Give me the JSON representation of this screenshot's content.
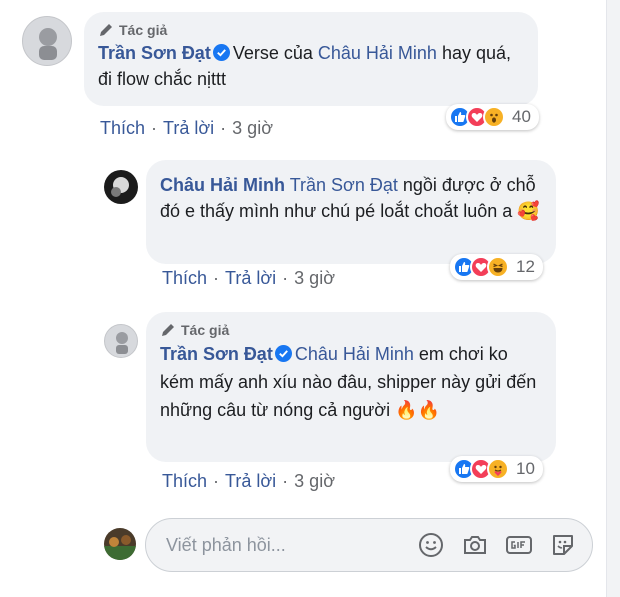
{
  "comments": [
    {
      "author_badge": "Tác giả",
      "author": "Trần Sơn Đạt",
      "mention": "",
      "text_before_mention": "Verse của ",
      "inline_mention": "Châu Hải Minh",
      "text": " hay quá, đi flow chắc nịttt",
      "actions": {
        "like": "Thích",
        "reply": "Trả lời",
        "time": "3 giờ"
      },
      "reactions": {
        "icons": [
          "like-icon",
          "love-icon",
          "wow-icon"
        ],
        "count": "40"
      }
    },
    {
      "author": "Châu Hải Minh",
      "mention": "Trần Sơn Đạt",
      "text": " ngồi được ở chỗ đó e thấy mình như chú pé loắt choắt luôn a 🥰",
      "actions": {
        "like": "Thích",
        "reply": "Trả lời",
        "time": "3 giờ"
      },
      "reactions": {
        "icons": [
          "like-icon",
          "love-icon",
          "haha-icon"
        ],
        "count": "12"
      }
    },
    {
      "author_badge": "Tác giả",
      "author": "Trần Sơn Đạt",
      "mention": "Châu Hải Minh",
      "text": " em chơi ko kém mấy anh xíu nào đâu, shipper này gửi đến những câu từ nóng cả người 🔥🔥",
      "actions": {
        "like": "Thích",
        "reply": "Trả lời",
        "time": "3 giờ"
      },
      "reactions": {
        "icons": [
          "like-icon",
          "love-icon",
          "care-icon"
        ],
        "count": "10"
      }
    }
  ],
  "reply_box": {
    "placeholder": "Viết phản hồi...",
    "icons": [
      "emoji-icon",
      "camera-icon",
      "gif-icon",
      "sticker-icon"
    ]
  },
  "colors": {
    "link": "#385898",
    "bubble": "#f0f2f5",
    "like": "#1877f2",
    "love": "#f33e58",
    "emoji": "#f7b125"
  }
}
